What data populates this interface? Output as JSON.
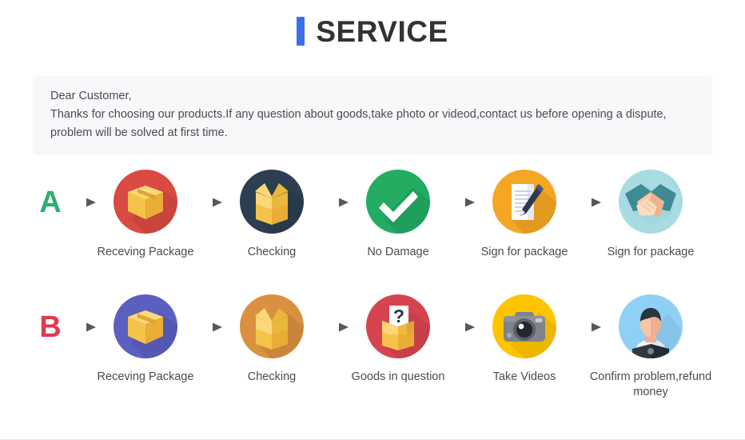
{
  "header": {
    "title": "SERVICE",
    "accent_color": "#3b6fe8",
    "title_color": "#333333"
  },
  "notice": {
    "background": "#f7f8fa",
    "lines": [
      "Dear Customer,",
      "Thanks for choosing our products.If any question about goods,take photo or videod,contact us before opening a dispute,",
      "problem will be solved at first time."
    ]
  },
  "rows": [
    {
      "letter": "A",
      "letter_color": "#2fae6e",
      "steps": [
        {
          "label": "Receving Package",
          "icon": "closed-box-icon",
          "circle_color": "#d94a42"
        },
        {
          "label": "Checking",
          "icon": "open-box-icon",
          "circle_color": "#2c3e50"
        },
        {
          "label": "No Damage",
          "icon": "checkmark-icon",
          "circle_color": "#23ab62"
        },
        {
          "label": "Sign for package",
          "icon": "document-pen-icon",
          "circle_color": "#f5a623"
        },
        {
          "label": "Sign for package",
          "icon": "handshake-icon",
          "circle_color": "#a8dbe2"
        }
      ]
    },
    {
      "letter": "B",
      "letter_color": "#e03a4e",
      "steps": [
        {
          "label": "Receving Package",
          "icon": "closed-box-icon",
          "circle_color": "#5b5fc0"
        },
        {
          "label": "Checking",
          "icon": "open-box-icon",
          "circle_color": "#d9913f"
        },
        {
          "label": "Goods in question",
          "icon": "question-box-icon",
          "circle_color": "#d6444f"
        },
        {
          "label": "Take Videos",
          "icon": "camera-icon",
          "circle_color": "#ffc400"
        },
        {
          "label": "Confirm  problem,refund money",
          "icon": "person-icon",
          "circle_color": "#8fd0f5"
        }
      ]
    }
  ],
  "arrow": {
    "name": "arrow-right-icon",
    "color": "#55595f"
  }
}
